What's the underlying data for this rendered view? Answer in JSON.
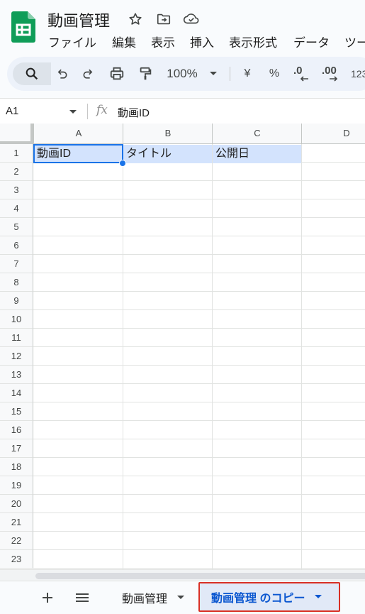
{
  "header": {
    "title": "動画管理",
    "menu": [
      "ファイル",
      "編集",
      "表示",
      "挿入",
      "表示形式",
      "データ",
      "ツー"
    ]
  },
  "toolbar": {
    "zoom": "100%",
    "currency": "¥",
    "percent": "%",
    "dec_decrease": ".0",
    "dec_increase": ".00",
    "number_format": "123"
  },
  "formula_bar": {
    "name_box": "A1",
    "fx": "fx",
    "formula": "動画ID"
  },
  "grid": {
    "columns": [
      "A",
      "B",
      "C",
      "D"
    ],
    "rows": [
      "1",
      "2",
      "3",
      "4",
      "5",
      "6",
      "7",
      "8",
      "9",
      "10",
      "11",
      "12",
      "13",
      "14",
      "15",
      "16",
      "17",
      "18",
      "19",
      "20",
      "21",
      "22",
      "23"
    ],
    "cells": {
      "A1": "動画ID",
      "B1": "タイトル",
      "C1": "公開日"
    },
    "selected_cell": "A1"
  },
  "sheets": {
    "tabs": [
      "動画管理",
      "動画管理 のコピー"
    ],
    "active": "動画管理 のコピー"
  },
  "colors": {
    "brand": "#0f9d58",
    "accent": "#1a73e8",
    "header_fill": "#d3e3fd",
    "highlight_border": "#d93025"
  }
}
